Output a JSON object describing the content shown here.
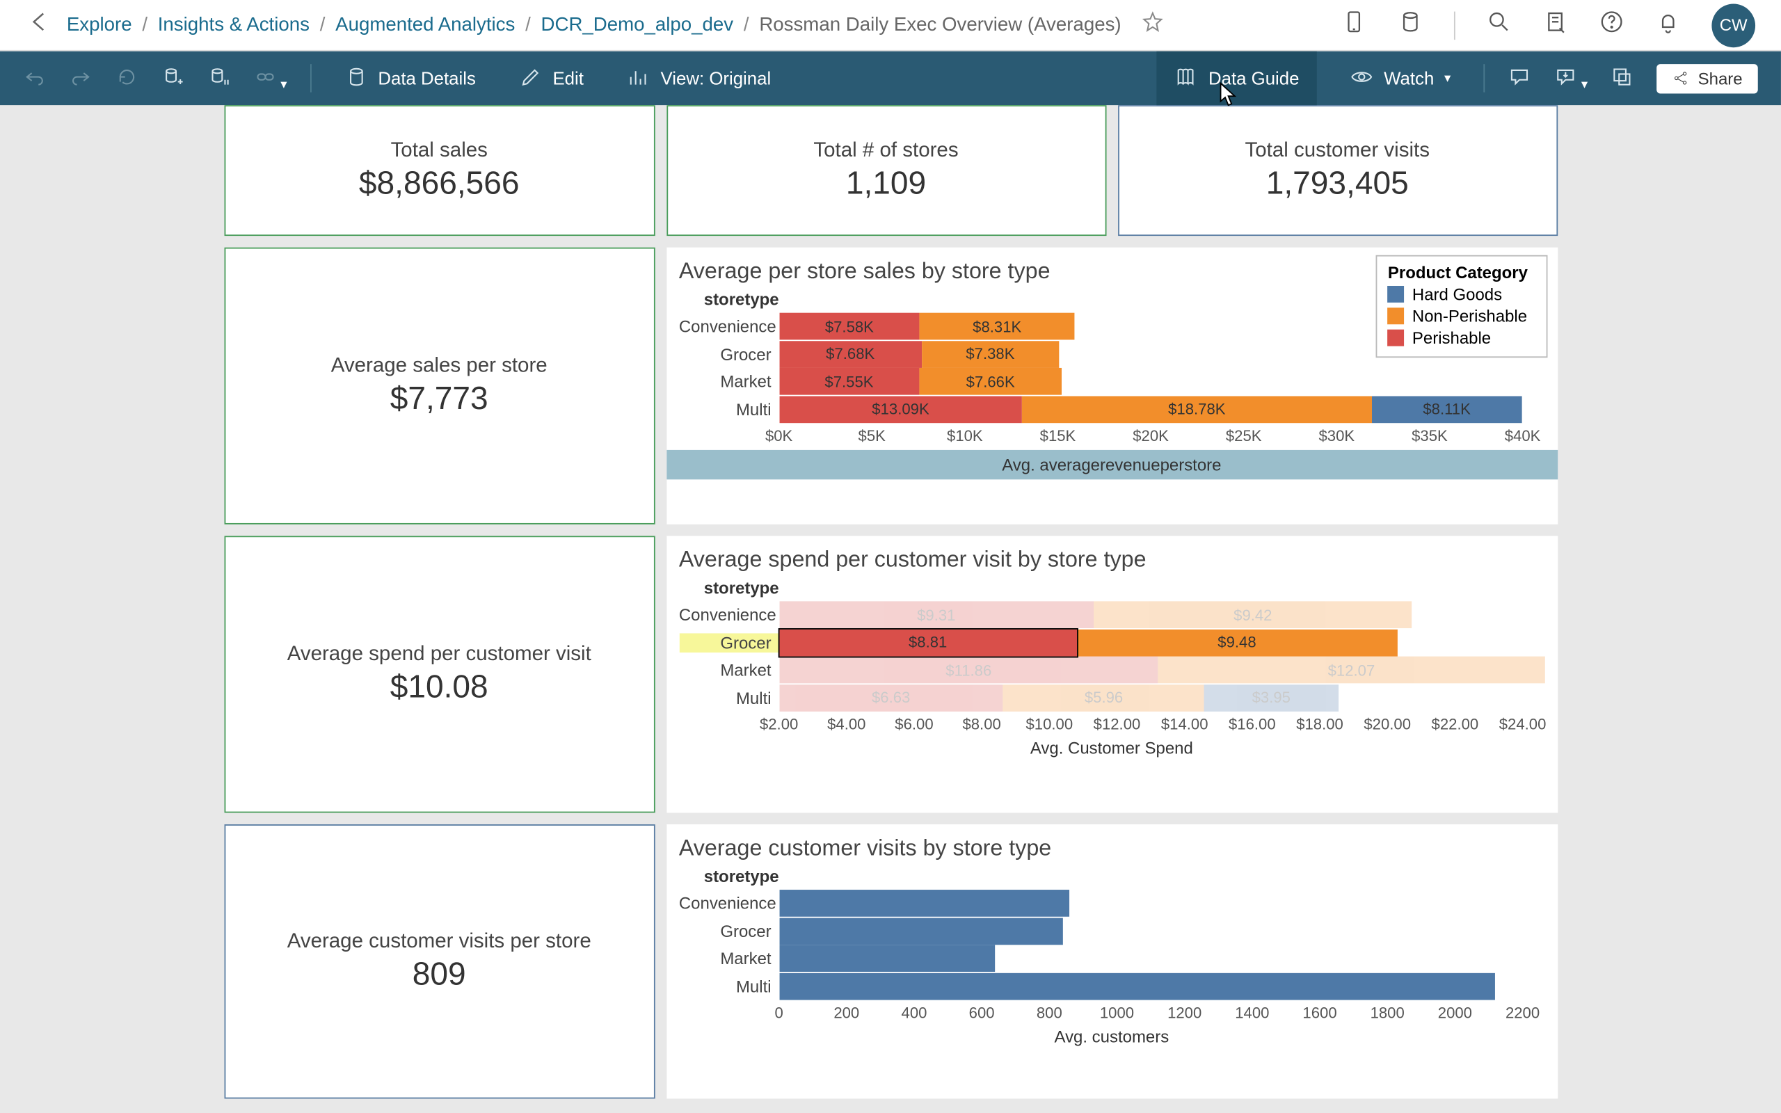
{
  "breadcrumb": {
    "items": [
      "Explore",
      "Insights & Actions",
      "Augmented Analytics",
      "DCR_Demo_alpo_dev"
    ],
    "current": "Rossman Daily Exec Overview (Averages)"
  },
  "avatar": "CW",
  "toolbar": {
    "dataDetails": "Data Details",
    "edit": "Edit",
    "view": "View: Original",
    "dataGuide": "Data Guide",
    "watch": "Watch",
    "share": "Share"
  },
  "kpis": {
    "0": {
      "label": "Total sales",
      "value": "$8,866,566"
    },
    "1": {
      "label": "Total # of stores",
      "value": "1,109"
    },
    "2": {
      "label": "Total customer visits",
      "value": "1,793,405"
    }
  },
  "bigkpis": {
    "0": {
      "label": "Average sales per store",
      "value": "$7,773"
    },
    "1": {
      "label": "Average spend per customer visit",
      "value": "$10.08"
    },
    "2": {
      "label": "Average customer visits per store",
      "value": "809"
    }
  },
  "legend": {
    "title": "Product Category",
    "items": [
      "Hard Goods",
      "Non-Perishable",
      "Perishable"
    ]
  },
  "chart_data": [
    {
      "type": "bar",
      "title": "Average per store sales by store type",
      "row_header": "storetype",
      "xlabel": "Avg. averagerevenueperstore",
      "xlim": [
        0,
        40000
      ],
      "ticks": [
        "$0K",
        "$5K",
        "$10K",
        "$15K",
        "$20K",
        "$25K",
        "$30K",
        "$35K",
        "$40K"
      ],
      "categories": [
        "Convenience",
        "Grocer",
        "Market",
        "Multi"
      ],
      "series": [
        {
          "name": "Perishable",
          "values": [
            7580,
            7680,
            7550,
            13090
          ],
          "labels": [
            "$7.58K",
            "$7.68K",
            "$7.55K",
            "$13.09K"
          ]
        },
        {
          "name": "Non-Perishable",
          "values": [
            8310,
            7380,
            7660,
            18780
          ],
          "labels": [
            "$8.31K",
            "$7.38K",
            "$7.66K",
            "$18.78K"
          ]
        },
        {
          "name": "Hard Goods",
          "values": [
            null,
            null,
            null,
            8110
          ],
          "labels": [
            "",
            "",
            "",
            "$8.11K"
          ]
        }
      ]
    },
    {
      "type": "bar",
      "title": "Average spend per customer visit by store type",
      "row_header": "storetype",
      "xlabel": "Avg. Customer Spend",
      "xlim": [
        2,
        24
      ],
      "ticks": [
        "$2.00",
        "$4.00",
        "$6.00",
        "$8.00",
        "$10.00",
        "$12.00",
        "$14.00",
        "$16.00",
        "$18.00",
        "$20.00",
        "$22.00",
        "$24.00"
      ],
      "categories": [
        "Convenience",
        "Grocer",
        "Market",
        "Multi"
      ],
      "highlight_row": "Grocer",
      "series": [
        {
          "name": "Perishable",
          "values": [
            9.31,
            8.81,
            11.86,
            6.63
          ],
          "labels": [
            "$9.31",
            "$8.81",
            "$11.86",
            "$6.63"
          ]
        },
        {
          "name": "Non-Perishable",
          "values": [
            9.42,
            9.48,
            12.07,
            5.96
          ],
          "labels": [
            "$9.42",
            "$9.48",
            "$12.07",
            "$5.96"
          ]
        },
        {
          "name": "Hard Goods",
          "values": [
            null,
            null,
            null,
            3.95
          ],
          "labels": [
            "",
            "",
            "",
            "$3.95"
          ]
        }
      ],
      "selected": {
        "row": "Grocer",
        "series": "Perishable"
      }
    },
    {
      "type": "bar",
      "title": "Average customer visits by store type",
      "row_header": "storetype",
      "xlabel": "Avg. customers",
      "xlim": [
        0,
        2200
      ],
      "ticks": [
        "0",
        "200",
        "400",
        "600",
        "800",
        "1000",
        "1200",
        "1400",
        "1600",
        "1800",
        "2000",
        "2200"
      ],
      "categories": [
        "Convenience",
        "Grocer",
        "Market",
        "Multi"
      ],
      "series": [
        {
          "name": "Avg. customers",
          "values": [
            860,
            840,
            640,
            2120
          ]
        }
      ]
    }
  ]
}
